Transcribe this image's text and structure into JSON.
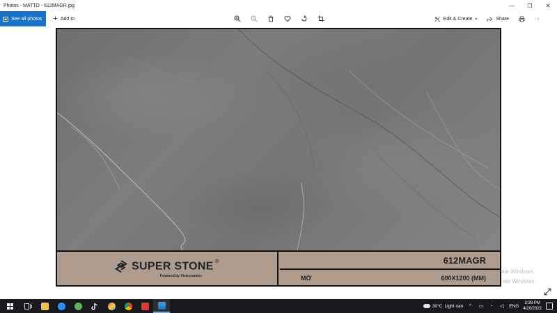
{
  "window": {
    "title": "Photos - MATTO - 612MAGR.jpg",
    "minimize": "—",
    "maximize": "❐",
    "close": "✕"
  },
  "toolbar": {
    "see_all_label": "See all photos",
    "add_to_label": "Add to",
    "edit_create_label": "Edit & Create",
    "share_label": "Share"
  },
  "photo": {
    "brand_name": "SUPER STONE",
    "brand_registered": "®",
    "brand_tagline": "Powered by Vietceramics",
    "product_code": "612MAGR",
    "finish": "MỜ",
    "size": "600X1200 (MM)",
    "colors": {
      "label_bg": "#ae9d8f",
      "stone_base": "#7a7a7a"
    }
  },
  "watermark": {
    "line1": "ate Windows",
    "line2": "ate Windows."
  },
  "taskbar": {
    "weather_temp": "30°C",
    "weather_desc": "Light rain",
    "language": "ENG",
    "time": "3:38 PM",
    "date": "4/20/2022",
    "accent": "#17191c"
  }
}
